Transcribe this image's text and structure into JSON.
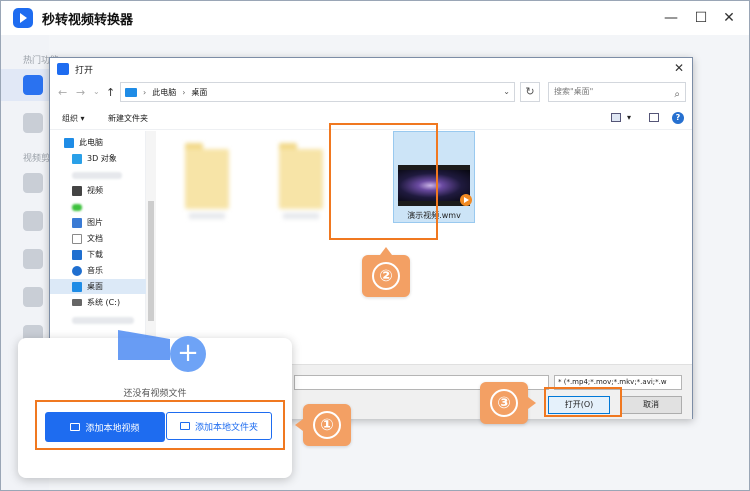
{
  "app": {
    "title": "秒转视频转换器",
    "sidebar_section_1": "热门功能",
    "sidebar_section_2": "视频剪",
    "minimize": "—",
    "maximize": "☐",
    "close": "✕"
  },
  "dialog": {
    "title": "打开",
    "close": "✕",
    "nav_back": "←",
    "nav_forward": "→",
    "nav_dropdown": "⌄",
    "nav_up": "↑",
    "breadcrumb": [
      "此电脑",
      "桌面"
    ],
    "breadcrumb_sep": "›",
    "search_placeholder": "搜索\"桌面\"",
    "search_icon": "⌕",
    "refresh": "↻",
    "dropdown_arrow": "⌄",
    "toolbar": {
      "organize": "组织 ▾",
      "new_folder": "新建文件夹",
      "view_dropdown": "▾",
      "help": "?"
    },
    "nav_items": [
      {
        "label": "此电脑",
        "icon": "pc-icon",
        "color": "#1f8ce6"
      },
      {
        "label": "3D 对象",
        "icon": "cube-icon",
        "color": "#2aa0e8"
      },
      {
        "label": "视频",
        "icon": "video-icon",
        "color": "#444444"
      },
      {
        "label": "图片",
        "icon": "picture-icon",
        "color": "#3a7bd5"
      },
      {
        "label": "文档",
        "icon": "document-icon",
        "color": "#8a8a8a"
      },
      {
        "label": "下载",
        "icon": "download-icon",
        "color": "#1f6fd0"
      },
      {
        "label": "音乐",
        "icon": "music-icon",
        "color": "#1f6fd0"
      },
      {
        "label": "桌面",
        "icon": "desktop-icon",
        "color": "#1f8ce6"
      },
      {
        "label": "系统 (C:)",
        "icon": "drive-icon",
        "color": "#666666"
      }
    ],
    "file": {
      "name": "演示视频.wmv",
      "icon": "video-thumbnail"
    },
    "file_type": "* (*.mp4;*.mov;*.mkv;*.avi;*.w",
    "open_button": "打开(O)",
    "cancel_button": "取消"
  },
  "card": {
    "empty_text": "还没有视频文件",
    "add_video_button": "添加本地视频",
    "add_folder_button": "添加本地文件夹",
    "plus": "+"
  },
  "callouts": {
    "step1": "①",
    "step2": "②",
    "step3": "③",
    "color": "#f07820"
  }
}
